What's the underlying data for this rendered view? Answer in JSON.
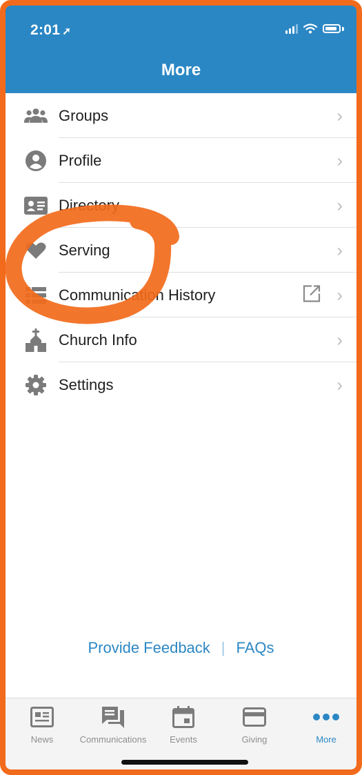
{
  "status": {
    "time": "2:01"
  },
  "header": {
    "title": "More"
  },
  "menu": [
    {
      "label": "Groups",
      "icon": "group-icon"
    },
    {
      "label": "Profile",
      "icon": "profile-icon"
    },
    {
      "label": "Directory",
      "icon": "directory-icon"
    },
    {
      "label": "Serving",
      "icon": "heart-icon"
    },
    {
      "label": "Communication History",
      "icon": "list-icon",
      "external": true
    },
    {
      "label": "Church Info",
      "icon": "church-icon"
    },
    {
      "label": "Settings",
      "icon": "gear-icon"
    }
  ],
  "links": {
    "feedback": "Provide Feedback",
    "faqs": "FAQs"
  },
  "tabs": [
    {
      "label": "News",
      "icon": "news-icon"
    },
    {
      "label": "Communications",
      "icon": "communications-icon"
    },
    {
      "label": "Events",
      "icon": "calendar-icon"
    },
    {
      "label": "Giving",
      "icon": "card-icon"
    },
    {
      "label": "More",
      "icon": "more-icon",
      "active": true
    }
  ],
  "colors": {
    "accent": "#2b87c4",
    "annotation": "#f26a1b",
    "icon": "#7b7b7b"
  }
}
